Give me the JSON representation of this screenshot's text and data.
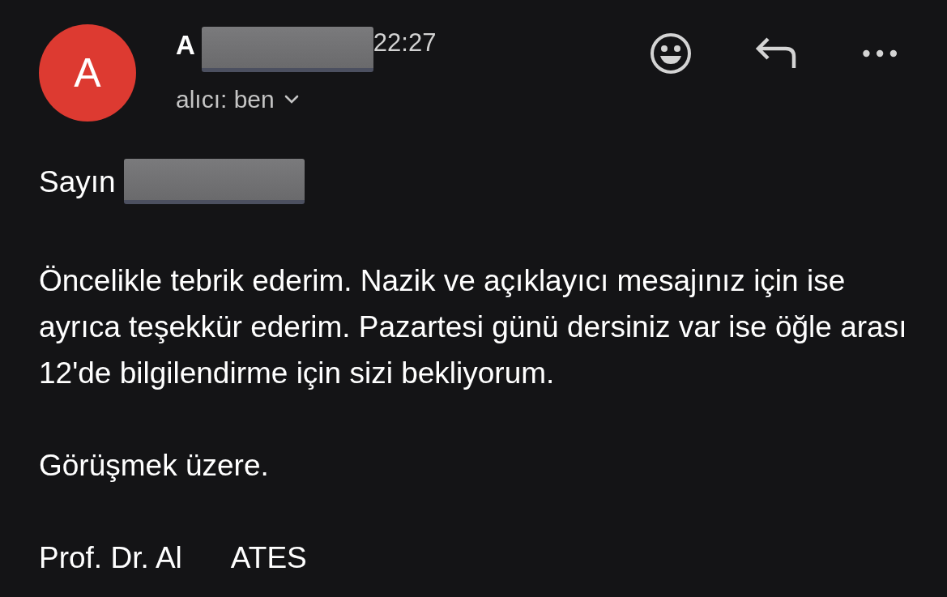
{
  "message": {
    "avatar": {
      "letter": "A",
      "color": "#dd3a31"
    },
    "sender": "A",
    "time": "22:27",
    "recipient": "alıcı: ben",
    "greeting": "Sayın",
    "paragraphs": [
      "Öncelikle tebrik ederim. Nazik ve açıklayıcı mesajınız için ise ayrıca teşekkür ederim. Pazartesi günü dersiniz var ise öğle arası 12'de bilgilendirme için sizi bekliyorum.",
      "Görüşmek üzere."
    ],
    "signature": [
      "Prof. Dr. Al",
      "ATES"
    ]
  }
}
